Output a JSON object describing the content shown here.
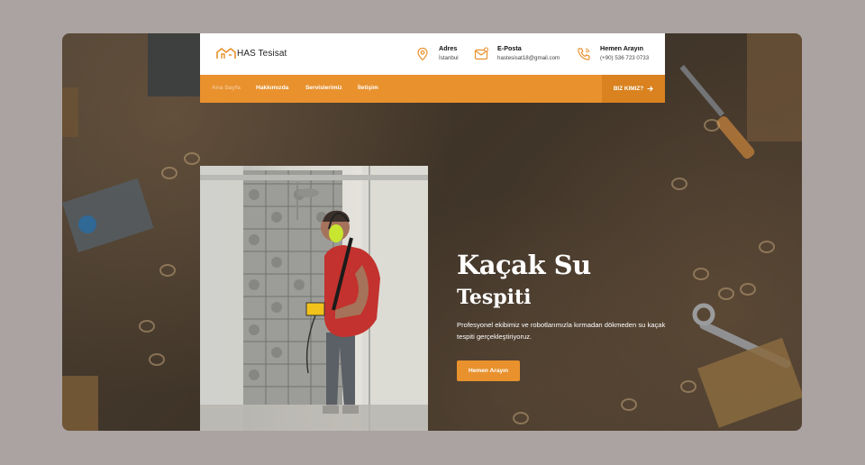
{
  "brand": {
    "name": "HAS Tesisat"
  },
  "header": {
    "contacts": [
      {
        "icon": "location-pin-icon",
        "title": "Adres",
        "value": "İstanbul"
      },
      {
        "icon": "mail-icon",
        "title": "E-Posta",
        "value": "hastesisat18@gmail.com"
      },
      {
        "icon": "phone-icon",
        "title": "Hemen Arayın",
        "value": "(+90) 536 723 0733"
      }
    ]
  },
  "nav": {
    "items": [
      "Ana Sayfa",
      "Hakkımızda",
      "Servislerimiz",
      "İletişim"
    ],
    "active": "Ana Sayfa",
    "cta": "BIZ KIMIZ?"
  },
  "hero": {
    "title_line1": "Kaçak Su",
    "title_line2": "Tespiti",
    "description": "Profesyonel ekibimiz ve robotlarımızla kırmadan dökmeden su kaçak tespiti gerçekleştiriyoruz.",
    "button": "Hemen Arayın"
  },
  "colors": {
    "accent": "#e8912d",
    "accent_dark": "#d9821f",
    "page_bg": "#aba3a1",
    "hero_bg": "#433729"
  }
}
